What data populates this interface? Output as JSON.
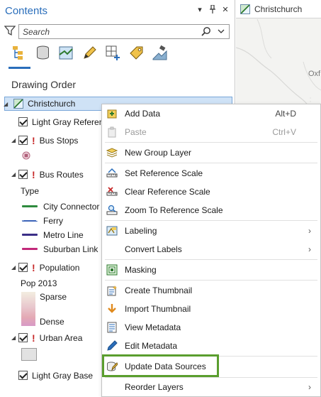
{
  "pane": {
    "title": "Contents",
    "search_placeholder": "Search",
    "section_title": "Drawing Order"
  },
  "layers": {
    "map": "Christchurch",
    "light_gray_ref": "Light Gray Reference",
    "bus_stops": "Bus Stops",
    "bus_routes": "Bus Routes",
    "type_heading": "Type",
    "routes": [
      {
        "label": "City Connector",
        "color": "#2e8b3e",
        "style": "solid"
      },
      {
        "label": "Ferry",
        "color": "#3a63b8",
        "style": "dashed"
      },
      {
        "label": "Metro Line",
        "color": "#3b2f87",
        "style": "solid"
      },
      {
        "label": "Suburban Link",
        "color": "#c2297a",
        "style": "solid"
      }
    ],
    "population": "Population",
    "pop_heading": "Pop 2013",
    "sparse": "Sparse",
    "dense": "Dense",
    "urban_area": "Urban Area",
    "light_gray_base": "Light Gray Base"
  },
  "map_view": {
    "tab": "Christchurch",
    "place_label": "Oxf"
  },
  "menu": {
    "items": [
      {
        "label": "Add Data",
        "shortcut": "Alt+D"
      },
      {
        "label": "Paste",
        "shortcut": "Ctrl+V"
      },
      {
        "label": "New Group Layer"
      },
      {
        "label": "Set Reference Scale"
      },
      {
        "label": "Clear Reference Scale"
      },
      {
        "label": "Zoom To Reference Scale"
      },
      {
        "label": "Labeling"
      },
      {
        "label": "Convert Labels"
      },
      {
        "label": "Masking"
      },
      {
        "label": "Create Thumbnail"
      },
      {
        "label": "Import Thumbnail"
      },
      {
        "label": "View Metadata"
      },
      {
        "label": "Edit Metadata"
      },
      {
        "label": "Update Data Sources"
      },
      {
        "label": "Reorder Layers"
      }
    ],
    "highlight_color": "#5a9e2e"
  },
  "colors": {
    "accent": "#2a6ebb",
    "selection": "#cfe2f6",
    "warning": "#c62828"
  }
}
